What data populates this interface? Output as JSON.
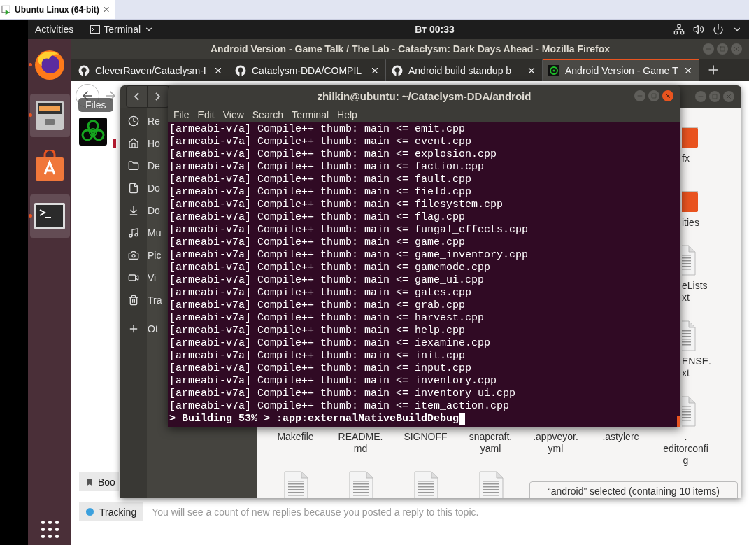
{
  "host_tab": {
    "label": "Ubuntu Linux (64-bit)"
  },
  "top_bar": {
    "activities": "Activities",
    "app_menu": "Terminal",
    "clock": "Вт 00:33"
  },
  "dock": {
    "items": [
      {
        "kind": "firefox",
        "running": true,
        "highlighted": false
      },
      {
        "kind": "files",
        "running": true,
        "highlighted": true
      },
      {
        "kind": "software",
        "running": false,
        "highlighted": false
      },
      {
        "kind": "terminal",
        "running": true,
        "highlighted": true
      }
    ],
    "tooltip": "Files"
  },
  "firefox": {
    "title": "Android Version - Game Talk / The Lab - Cataclysm: Dark Days Ahead - Mozilla Firefox",
    "tabs": [
      {
        "kind": "github",
        "label": "CleverRaven/Cataclysm-I",
        "selected": false
      },
      {
        "kind": "github",
        "label": "Cataclysm-DDA/COMPIL",
        "selected": false
      },
      {
        "kind": "github",
        "label": "Android build standup b",
        "selected": false
      },
      {
        "kind": "site",
        "label": "Android Version - Game T",
        "selected": true
      }
    ],
    "page": {
      "bookmark_button": "Boo",
      "tracking_button": "Tracking",
      "tracking_text": "You will see a count of new replies because you posted a reply to this topic."
    }
  },
  "files": {
    "sidebar": [
      {
        "kind": "recent",
        "label": "Re"
      },
      {
        "kind": "home",
        "label": "Ho"
      },
      {
        "kind": "desktop",
        "label": "De"
      },
      {
        "kind": "documents",
        "label": "Do"
      },
      {
        "kind": "downloads",
        "label": "Do"
      },
      {
        "kind": "music",
        "label": "Mu"
      },
      {
        "kind": "pictures",
        "label": "Pic"
      },
      {
        "kind": "videos",
        "label": "Vi"
      },
      {
        "kind": "trash",
        "label": "Tra"
      },
      {
        "kind": "other",
        "label": "Ot"
      }
    ],
    "side_column": [
      {
        "kind": "folder",
        "lines": [
          "fx"
        ]
      },
      {
        "kind": "folder",
        "lines": [
          "ities"
        ]
      },
      {
        "kind": "document",
        "lines": [
          "eLists",
          "xt"
        ]
      },
      {
        "kind": "document",
        "lines": [
          "ENSE.",
          "xt"
        ]
      }
    ],
    "bottom_row": [
      {
        "kind": "none",
        "lines": [
          "Makefile"
        ]
      },
      {
        "kind": "none",
        "lines": [
          "README.",
          "md"
        ]
      },
      {
        "kind": "none",
        "lines": [
          "SIGNOFF"
        ]
      },
      {
        "kind": "none",
        "lines": [
          "snapcraft.",
          "yaml"
        ]
      },
      {
        "kind": "none",
        "lines": [
          ".appveyor.",
          "yml"
        ]
      },
      {
        "kind": "none",
        "lines": [
          ".astylerc"
        ]
      },
      {
        "kind": "document",
        "lines": [
          ".",
          "editorconfi",
          "g"
        ]
      }
    ],
    "last_row": [
      {
        "kind": "document"
      },
      {
        "kind": "document"
      },
      {
        "kind": "document"
      },
      {
        "kind": "document"
      }
    ],
    "status": "“android” selected  (containing 10 items)"
  },
  "terminal": {
    "title": "zhilkin@ubuntu: ~/Cataclysm-DDA/android",
    "menu": [
      "File",
      "Edit",
      "View",
      "Search",
      "Terminal",
      "Help"
    ],
    "lines": [
      "[armeabi-v7a] Compile++ thumb: main <= emit.cpp",
      "[armeabi-v7a] Compile++ thumb: main <= event.cpp",
      "[armeabi-v7a] Compile++ thumb: main <= explosion.cpp",
      "[armeabi-v7a] Compile++ thumb: main <= faction.cpp",
      "[armeabi-v7a] Compile++ thumb: main <= fault.cpp",
      "[armeabi-v7a] Compile++ thumb: main <= field.cpp",
      "[armeabi-v7a] Compile++ thumb: main <= filesystem.cpp",
      "[armeabi-v7a] Compile++ thumb: main <= flag.cpp",
      "[armeabi-v7a] Compile++ thumb: main <= fungal_effects.cpp",
      "[armeabi-v7a] Compile++ thumb: main <= game.cpp",
      "[armeabi-v7a] Compile++ thumb: main <= game_inventory.cpp",
      "[armeabi-v7a] Compile++ thumb: main <= gamemode.cpp",
      "[armeabi-v7a] Compile++ thumb: main <= game_ui.cpp",
      "[armeabi-v7a] Compile++ thumb: main <= gates.cpp",
      "[armeabi-v7a] Compile++ thumb: main <= grab.cpp",
      "[armeabi-v7a] Compile++ thumb: main <= harvest.cpp",
      "[armeabi-v7a] Compile++ thumb: main <= help.cpp",
      "[armeabi-v7a] Compile++ thumb: main <= iexamine.cpp",
      "[armeabi-v7a] Compile++ thumb: main <= init.cpp",
      "[armeabi-v7a] Compile++ thumb: main <= input.cpp",
      "[armeabi-v7a] Compile++ thumb: main <= inventory.cpp",
      "[armeabi-v7a] Compile++ thumb: main <= inventory_ui.cpp",
      "[armeabi-v7a] Compile++ thumb: main <= item_action.cpp"
    ],
    "prompt": "> Building 53% > :app:externalNativeBuildDebug"
  }
}
